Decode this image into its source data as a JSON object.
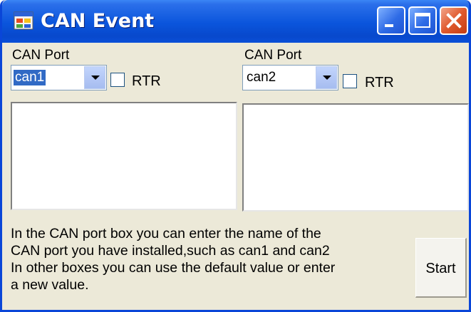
{
  "window": {
    "title": "CAN Event",
    "icon": "app-window-icon",
    "controls": [
      "minimize-icon",
      "maximize-icon",
      "close-icon"
    ]
  },
  "left_panel": {
    "port_label": "CAN Port",
    "port_value": "can1",
    "rtr_label": "RTR",
    "rtr_checked": false
  },
  "right_panel": {
    "port_label": "CAN Port",
    "port_value": "can2",
    "rtr_label": "RTR",
    "rtr_checked": false
  },
  "info_lines": [
    "In the CAN port box you can enter the name of the",
    "CAN port you have installed,such as can1 and can2",
    "In other boxes you can use the default value or enter",
    "a new value."
  ],
  "start_button": "Start",
  "colors": {
    "titlebar": "#0A55DC",
    "window_bg": "#ECE9D8",
    "selection": "#316AC5"
  }
}
